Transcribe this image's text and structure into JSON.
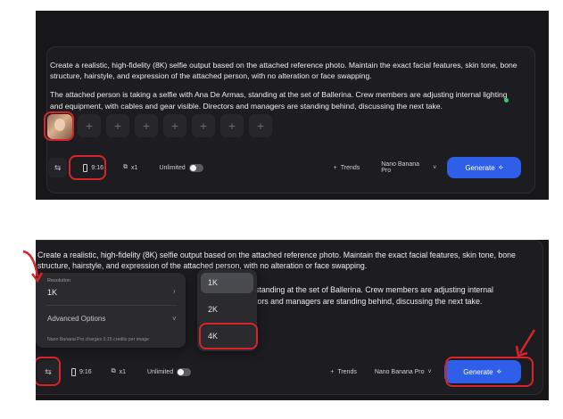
{
  "prompt": {
    "para1": "Create a realistic, high-fidelity (8K) selfie output based on the attached reference photo. Maintain the exact facial features, skin tone, bone structure, hairstyle, and expression of the attached person, with no alteration or face swapping.",
    "para2": "The attached person is taking a selfie with Ana De Armas, standing at the set of Ballerina. Crew members are adjusting internal lighting and equipment, with cables and gear visible. Directors and managers are standing behind, discussing the next take.",
    "para2_partial_lines": [
      "standing at the set of Ballerina. Crew members are adjusting internal",
      "tors and managers are standing behind, discussing the next take."
    ]
  },
  "toolbar": {
    "settings_icon": "⇆",
    "aspect_ratio": "9:16",
    "count": "x1",
    "unlimited_label": "Unlimited",
    "trends_label": "Trends",
    "model_label": "Nano Banana Pro",
    "generate_label": "Generate",
    "generate_icon": "⟡"
  },
  "resolution_menu": {
    "label": "Resolution",
    "value": "1K",
    "advanced_label": "Advanced Options",
    "charges_note": "Nano Banana Pro charges 0.15 credits per image",
    "options": [
      "1K",
      "2K",
      "4K"
    ],
    "selected": "1K"
  },
  "colors": {
    "accent": "#2f5fe8",
    "highlight": "#d9232a",
    "background": "#17171a"
  }
}
